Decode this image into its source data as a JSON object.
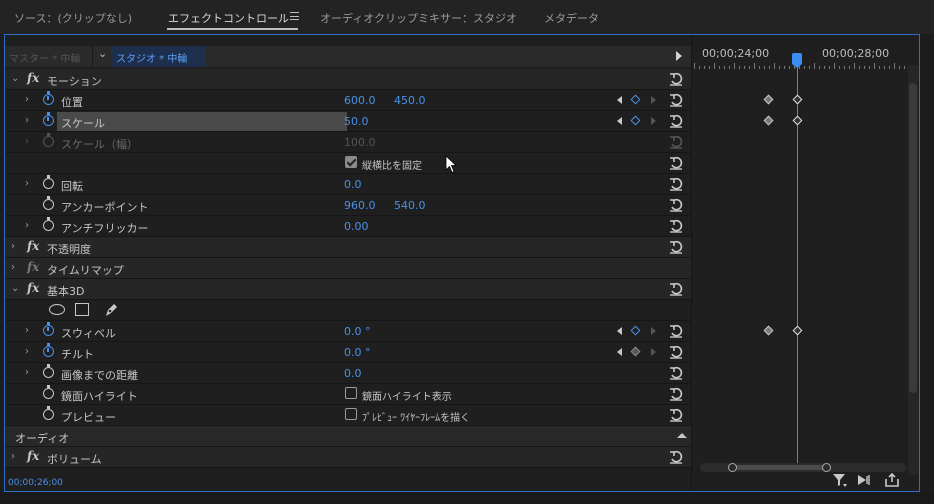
{
  "tabs": {
    "source": "ソース：(クリップなし)",
    "effect_controls": "エフェクトコントロール",
    "mixer": "オーディオクリップミキサー：スタジオ",
    "metadata": "メタデータ"
  },
  "source_bar": {
    "master": "マスター * 中輪",
    "sequence": "スタジオ * 中輪"
  },
  "timeline": {
    "time_left": "00;00;24;00",
    "time_right": "00;00;28;00"
  },
  "effects": {
    "motion": "モーション",
    "position": {
      "label": "位置",
      "x": "600.0",
      "y": "450.0"
    },
    "scale": {
      "label": "スケール",
      "value": "50.0"
    },
    "scale_width": {
      "label": "スケール（幅）",
      "value": "100.0"
    },
    "uniform_scale": {
      "label": "縦横比を固定"
    },
    "rotation": {
      "label": "回転",
      "value": "0.0"
    },
    "anchor": {
      "label": "アンカーポイント",
      "x": "960.0",
      "y": "540.0"
    },
    "antiflicker": {
      "label": "アンチフリッカー",
      "value": "0.00"
    },
    "opacity": "不透明度",
    "time_remap": "タイムリマップ",
    "basic3d": "基本3D",
    "swivel": {
      "label": "スウィベル",
      "value": "0.0 °"
    },
    "tilt": {
      "label": "チルト",
      "value": "0.0 °"
    },
    "distance": {
      "label": "画像までの距離",
      "value": "0.0"
    },
    "specular": {
      "label": "鏡面ハイライト",
      "check": "鏡面ハイライト表示"
    },
    "preview": {
      "label": "プレビュー",
      "check": "ﾌﾟﾚﾋﾞｭｰ ﾜｲﾔｰﾌﾚｰﾑを描く"
    },
    "audio": "オーディオ",
    "volume": "ボリューム"
  },
  "footer_time": "00;00;26;00",
  "colors": {
    "accent": "#4a90e8",
    "playhead": "#3b8ef0"
  },
  "icons": [
    "stopwatch-icon",
    "reset-icon",
    "keyframe-icon",
    "ellipse-mask-icon",
    "rect-mask-icon",
    "pen-mask-icon",
    "filter-icon",
    "play-only-icon",
    "export-icon"
  ]
}
